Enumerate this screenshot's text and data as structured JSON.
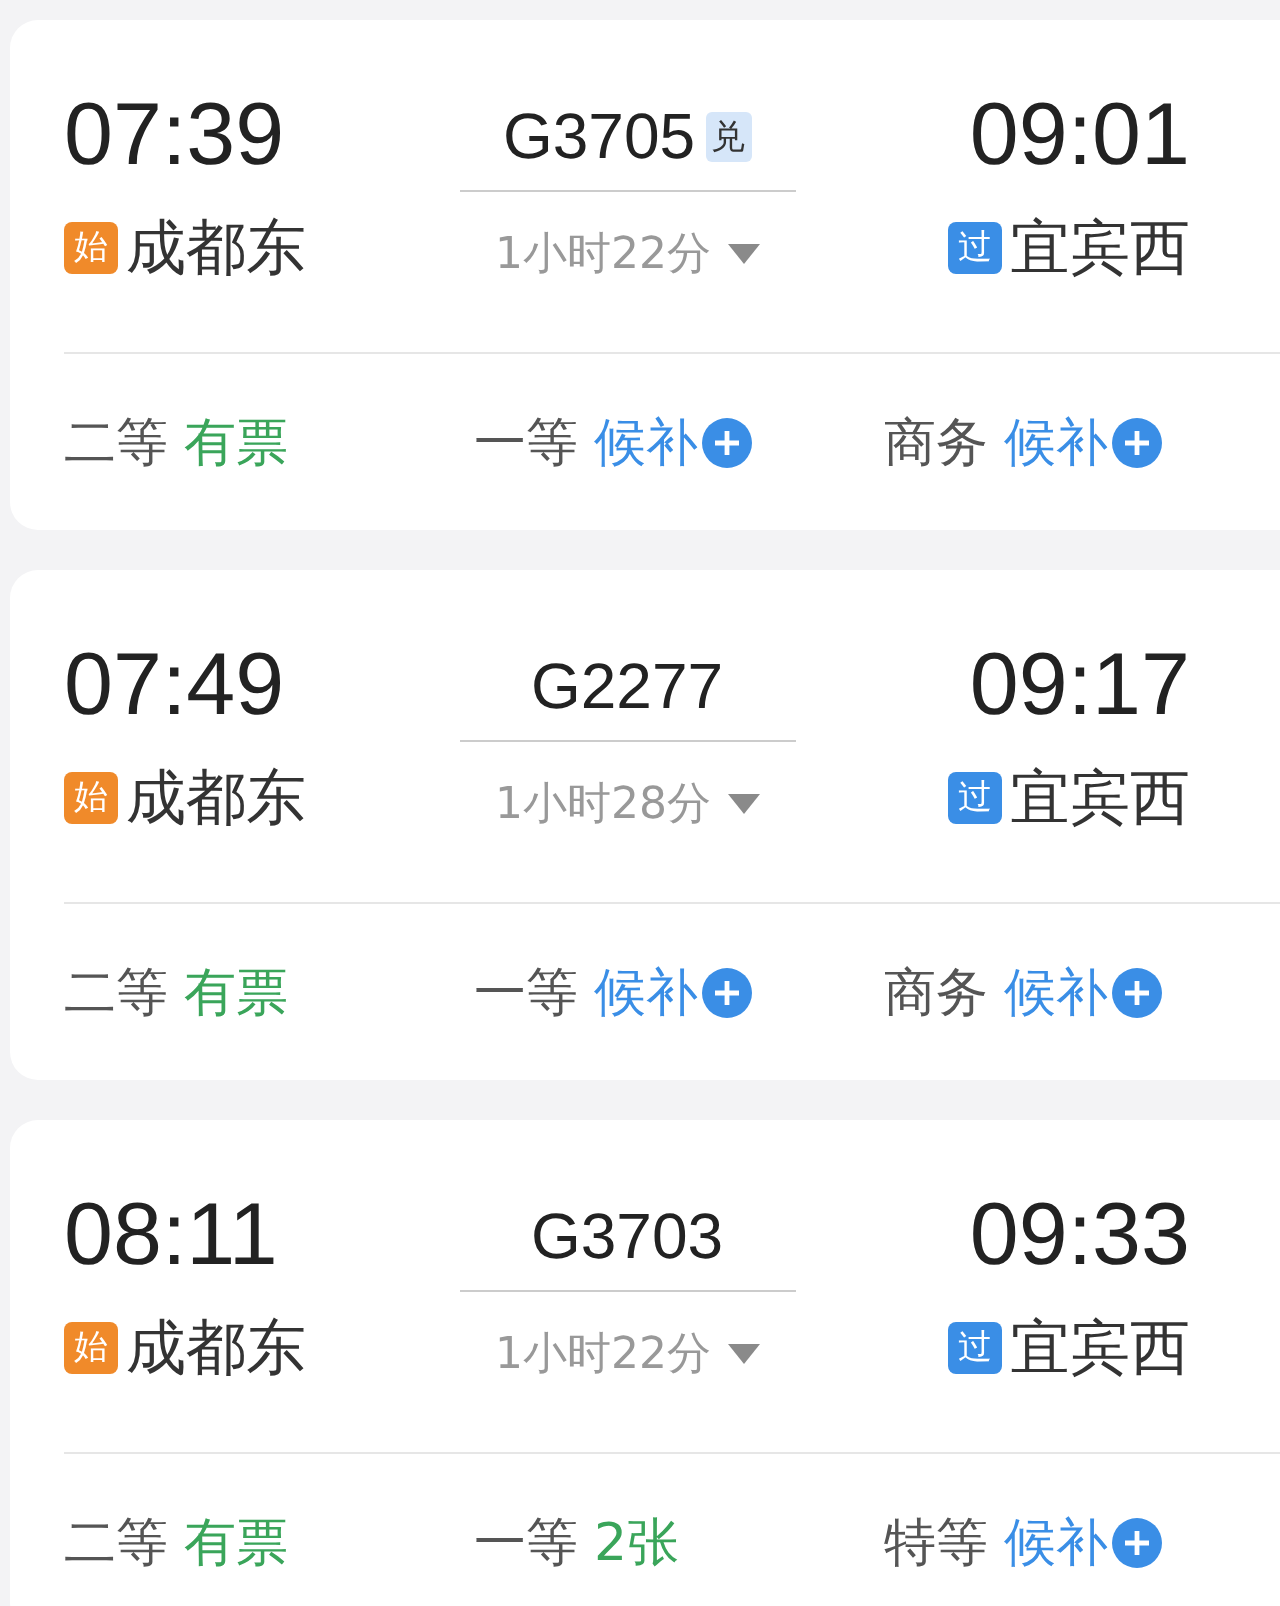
{
  "trains": [
    {
      "depart_time": "07:39",
      "train_no": "G3705",
      "tag": "兑",
      "duration": "1小时22分",
      "arrive_time": "09:01",
      "from": {
        "badge": "始",
        "kind": "origin",
        "name": "成都东"
      },
      "to": {
        "badge": "过",
        "kind": "pass",
        "name": "宜宾西"
      },
      "seats": [
        {
          "class": "二等",
          "status": "有票",
          "kind": "available"
        },
        {
          "class": "一等",
          "status": "候补",
          "kind": "waitlist"
        },
        {
          "class": "商务",
          "status": "候补",
          "kind": "waitlist"
        }
      ]
    },
    {
      "depart_time": "07:49",
      "train_no": "G2277",
      "duration": "1小时28分",
      "arrive_time": "09:17",
      "from": {
        "badge": "始",
        "kind": "origin",
        "name": "成都东"
      },
      "to": {
        "badge": "过",
        "kind": "pass",
        "name": "宜宾西"
      },
      "seats": [
        {
          "class": "二等",
          "status": "有票",
          "kind": "available"
        },
        {
          "class": "一等",
          "status": "候补",
          "kind": "waitlist"
        },
        {
          "class": "商务",
          "status": "候补",
          "kind": "waitlist"
        }
      ]
    },
    {
      "depart_time": "08:11",
      "train_no": "G3703",
      "duration": "1小时22分",
      "arrive_time": "09:33",
      "from": {
        "badge": "始",
        "kind": "origin",
        "name": "成都东"
      },
      "to": {
        "badge": "过",
        "kind": "pass",
        "name": "宜宾西"
      },
      "seats": [
        {
          "class": "二等",
          "status": "有票",
          "kind": "available"
        },
        {
          "class": "一等",
          "status": "2张",
          "kind": "available"
        },
        {
          "class": "特等",
          "status": "候补",
          "kind": "waitlist"
        }
      ]
    }
  ]
}
